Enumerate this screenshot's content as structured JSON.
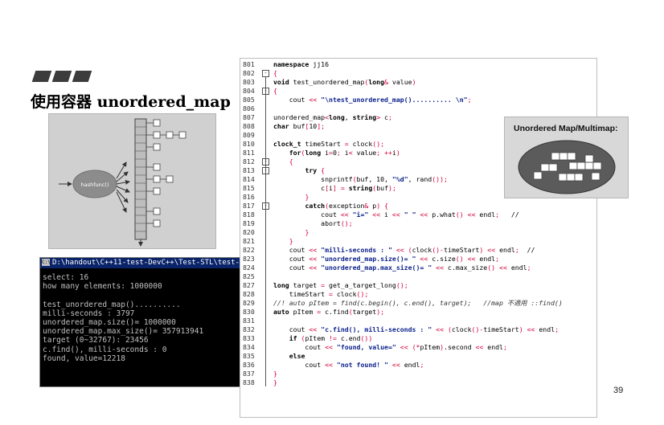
{
  "slide": {
    "title": "使用容器 unordered_map",
    "page_number": "39"
  },
  "diagram": {
    "hash_label": "hashfunc()"
  },
  "console": {
    "title": "D:\\handout\\C++11-test-DevC++\\Test-STL\\test-stl.e",
    "lines": [
      "select: 16",
      "how many elements: 1000000",
      "",
      "test_unordered_map()..........",
      "milli-seconds : 3797",
      "unordered_map.size()= 1000000",
      "unordered_map.max_size()= 357913941",
      "target (0~32767): 23456",
      "c.find(), milli-seconds : 0",
      "found, value=12218"
    ]
  },
  "code": {
    "lines": [
      {
        "n": "801",
        "t": "namespace jj16",
        "fold": ""
      },
      {
        "n": "802",
        "t": "{",
        "fold": "-"
      },
      {
        "n": "803",
        "t": "void test_unordered_map(long& value)",
        "fold": ""
      },
      {
        "n": "804",
        "t": "{",
        "fold": "-"
      },
      {
        "n": "805",
        "t": "    cout << \"\\ntest_unordered_map().......... \\n\";",
        "fold": ""
      },
      {
        "n": "806",
        "t": "",
        "fold": ""
      },
      {
        "n": "807",
        "t": "unordered_map<long, string> c;",
        "fold": ""
      },
      {
        "n": "808",
        "t": "char buf[10];",
        "fold": ""
      },
      {
        "n": "809",
        "t": "",
        "fold": ""
      },
      {
        "n": "810",
        "t": "clock_t timeStart = clock();",
        "fold": ""
      },
      {
        "n": "811",
        "t": "    for(long i=0; i< value; ++i)",
        "fold": ""
      },
      {
        "n": "812",
        "t": "    {",
        "fold": "-"
      },
      {
        "n": "813",
        "t": "        try {",
        "fold": "-"
      },
      {
        "n": "814",
        "t": "            snprintf(buf, 10, \"%d\", rand());",
        "fold": ""
      },
      {
        "n": "815",
        "t": "            c[i] = string(buf);",
        "fold": ""
      },
      {
        "n": "816",
        "t": "        }",
        "fold": ""
      },
      {
        "n": "817",
        "t": "        catch(exception& p) {",
        "fold": "-"
      },
      {
        "n": "818",
        "t": "            cout << \"i=\" << i << \" \" << p.what() << endl;   //",
        "fold": ""
      },
      {
        "n": "819",
        "t": "            abort();",
        "fold": ""
      },
      {
        "n": "820",
        "t": "        }",
        "fold": ""
      },
      {
        "n": "821",
        "t": "    }",
        "fold": ""
      },
      {
        "n": "822",
        "t": "    cout << \"milli-seconds : \" << (clock()-timeStart) << endl;  //",
        "fold": ""
      },
      {
        "n": "823",
        "t": "    cout << \"unordered_map.size()= \" << c.size() << endl;",
        "fold": ""
      },
      {
        "n": "824",
        "t": "    cout << \"unordered_map.max_size()= \" << c.max_size() << endl;",
        "fold": ""
      },
      {
        "n": "825",
        "t": "",
        "fold": ""
      },
      {
        "n": "827",
        "t": "long target = get_a_target_long();",
        "fold": ""
      },
      {
        "n": "828",
        "t": "    timeStart = clock();",
        "fold": ""
      },
      {
        "n": "829",
        "t": "//! auto pItem = find(c.begin(), c.end(), target);   //map 不適用 ::find()",
        "fold": ""
      },
      {
        "n": "830",
        "t": "auto pItem = c.find(target);",
        "fold": ""
      },
      {
        "n": "831",
        "t": "",
        "fold": ""
      },
      {
        "n": "832",
        "t": "    cout << \"c.find(), milli-seconds : \" << (clock()-timeStart) << endl;",
        "fold": ""
      },
      {
        "n": "833",
        "t": "    if (pItem != c.end())",
        "fold": ""
      },
      {
        "n": "834",
        "t": "        cout << \"found, value=\" << (*pItem).second << endl;",
        "fold": ""
      },
      {
        "n": "835",
        "t": "    else",
        "fold": ""
      },
      {
        "n": "836",
        "t": "        cout << \"not found! \" << endl;",
        "fold": ""
      },
      {
        "n": "837",
        "t": "}",
        "fold": ""
      },
      {
        "n": "838",
        "t": "}",
        "fold": ""
      }
    ]
  },
  "side_diagram": {
    "title": "Unordered Map/Multimap:"
  },
  "colors": {
    "keyword": "#000000",
    "string": "#0a1f8a",
    "operator": "#d3003a",
    "console_bg": "#000000",
    "console_title_bg": "#0a246a"
  }
}
